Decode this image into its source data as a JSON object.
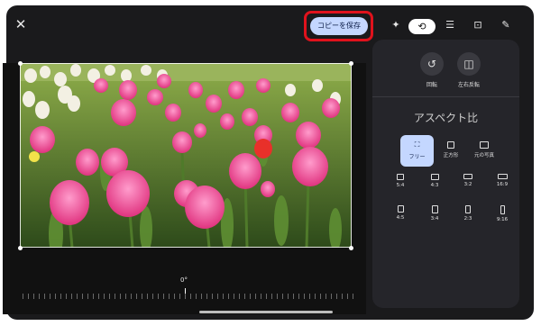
{
  "toolbar": {
    "close_icon": "close-icon",
    "save_label": "コピーを保存",
    "tools": [
      "sparkle-icon",
      "crop-rotate-icon",
      "adjust-icon",
      "markup-icon",
      "suggest-icon"
    ]
  },
  "panel": {
    "rotate_label": "回転",
    "flip_label": "左右反転",
    "aspect_title": "アスペクト比",
    "free_label": "フリー",
    "square_label": "正方形",
    "original_label": "元の写真",
    "ratios": [
      "5:4",
      "4:3",
      "3:2",
      "16:9",
      "4:5",
      "3:4",
      "2:3",
      "9:16"
    ]
  },
  "editor": {
    "angle": "0°"
  },
  "colors": {
    "accent": "#c4d7ff",
    "highlight": "#e0121c"
  }
}
